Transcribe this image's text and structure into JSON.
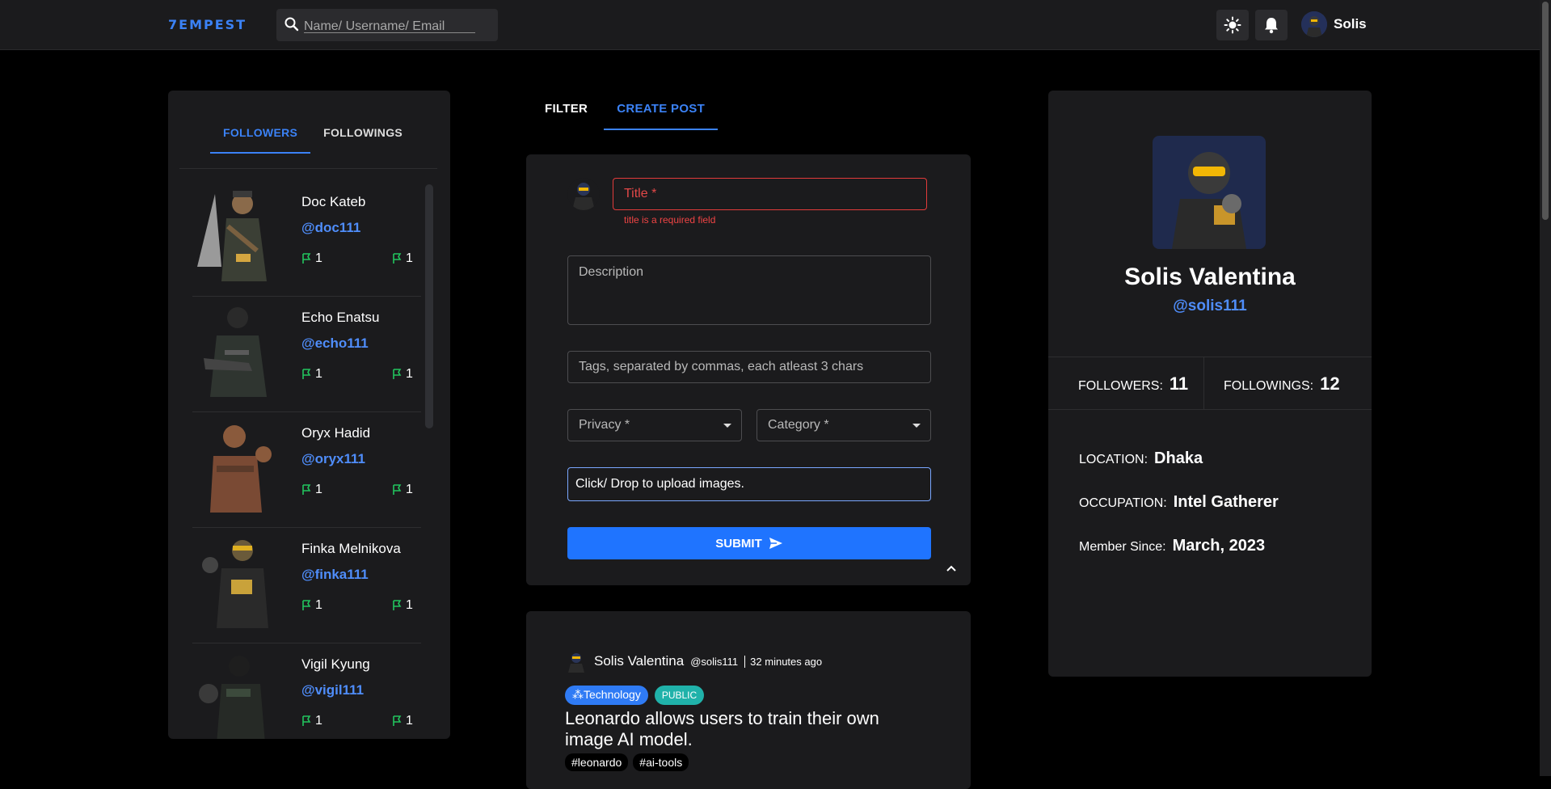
{
  "brand": {
    "logo": "7EMPEST"
  },
  "search": {
    "placeholder": "Name/ Username/ Email"
  },
  "header": {
    "user_name": "Solis"
  },
  "followers_panel": {
    "tabs": [
      "FOLLOWERS",
      "FOLLOWINGS"
    ],
    "active_tab": "FOLLOWERS",
    "items": [
      {
        "name": "Doc Kateb",
        "handle": "@doc111",
        "stat_a": "1",
        "stat_b": "1"
      },
      {
        "name": "Echo Enatsu",
        "handle": "@echo111",
        "stat_a": "1",
        "stat_b": "1"
      },
      {
        "name": "Oryx Hadid",
        "handle": "@oryx111",
        "stat_a": "1",
        "stat_b": "1"
      },
      {
        "name": "Finka Melnikova",
        "handle": "@finka111",
        "stat_a": "1",
        "stat_b": "1"
      },
      {
        "name": "Vigil Kyung",
        "handle": "@vigil111",
        "stat_a": "1",
        "stat_b": "1"
      }
    ]
  },
  "feed_tabs": {
    "filter": "FILTER",
    "create": "CREATE POST"
  },
  "create_form": {
    "title_placeholder": "Title *",
    "title_error": "title is a required field",
    "description_placeholder": "Description",
    "tags_placeholder": "Tags, separated by commas, each atleast 3 chars",
    "privacy_placeholder": "Privacy *",
    "category_placeholder": "Category *",
    "upload_label": "Click/ Drop to upload images.",
    "submit_label": "SUBMIT"
  },
  "post": {
    "author": "Solis Valentina",
    "handle": "@solis111",
    "time": "32 minutes ago",
    "category": "Technology",
    "privacy": "PUBLIC",
    "title": "Leonardo allows users to train their own image AI model.",
    "tags": [
      "leonardo",
      "ai-tools"
    ]
  },
  "profile": {
    "full_name": "Solis Valentina",
    "handle": "@solis111",
    "followers_label": "FOLLOWERS:",
    "followers_count": "11",
    "followings_label": "FOLLOWINGS:",
    "followings_count": "12",
    "location_label": "LOCATION:",
    "location": "Dhaka",
    "occupation_label": "OCCUPATION:",
    "occupation": "Intel Gatherer",
    "member_label": "Member Since:",
    "member_since": "March, 2023"
  },
  "colors": {
    "accent": "#3b82f6",
    "link": "#4f8dfa",
    "error": "#e23b3b",
    "success": "#22c55e",
    "panel": "#1b1b1d"
  }
}
